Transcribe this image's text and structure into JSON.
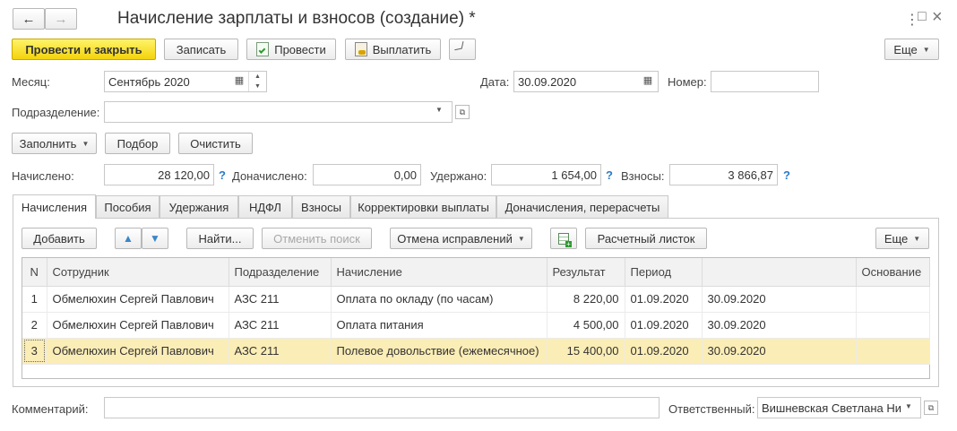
{
  "window": {
    "title": "Начисление зарплаты и взносов (создание) *",
    "more_icon": "⋮",
    "maximize_icon": "□",
    "close_icon": "×"
  },
  "nav": {
    "back": "🡐",
    "forward": "🡒"
  },
  "toolbar": {
    "post_and_close": "Провести и закрыть",
    "save": "Записать",
    "post": "Провести",
    "pay": "Выплатить",
    "more": "Еще"
  },
  "header": {
    "month_label": "Месяц:",
    "month_value": "Сентябрь 2020",
    "date_label": "Дата:",
    "date_value": "30.09.2020",
    "number_label": "Номер:",
    "number_value": "",
    "department_label": "Подразделение:",
    "department_value": ""
  },
  "actions": {
    "fill": "Заполнить",
    "select": "Подбор",
    "clear": "Очистить"
  },
  "totals": {
    "accrued_label": "Начислено:",
    "accrued_value": "28 120,00",
    "additional_label": "Доначислено:",
    "additional_value": "0,00",
    "withheld_label": "Удержано:",
    "withheld_value": "1 654,00",
    "contributions_label": "Взносы:",
    "contributions_value": "3 866,87",
    "help": "?"
  },
  "tabs": [
    {
      "label": "Начисления"
    },
    {
      "label": "Пособия"
    },
    {
      "label": "Удержания"
    },
    {
      "label": "НДФЛ"
    },
    {
      "label": "Взносы"
    },
    {
      "label": "Корректировки выплаты"
    },
    {
      "label": "Доначисления, перерасчеты"
    }
  ],
  "grid_toolbar": {
    "add": "Добавить",
    "find": "Найти...",
    "cancel_search": "Отменить поиск",
    "cancel_corrections": "Отмена исправлений",
    "payslip": "Расчетный листок",
    "more": "Еще"
  },
  "grid": {
    "columns": [
      "N",
      "Сотрудник",
      "Подразделение",
      "Начисление",
      "Результат",
      "Период",
      "",
      "Основание"
    ],
    "rows": [
      {
        "n": "1",
        "employee": "Обмелюхин Сергей Павлович",
        "department": "АЗС 211",
        "accrual": "Оплата по окладу (по часам)",
        "result": "8 220,00",
        "period_from": "01.09.2020",
        "period_to": "30.09.2020",
        "basis": ""
      },
      {
        "n": "2",
        "employee": "Обмелюхин Сергей Павлович",
        "department": "АЗС 211",
        "accrual": "Оплата питания",
        "result": "4 500,00",
        "period_from": "01.09.2020",
        "period_to": "30.09.2020",
        "basis": ""
      },
      {
        "n": "3",
        "employee": "Обмелюхин Сергей Павлович",
        "department": "АЗС 211",
        "accrual": "Полевое довольствие (ежемесячное)",
        "result": "15 400,00",
        "period_from": "01.09.2020",
        "period_to": "30.09.2020",
        "basis": ""
      }
    ]
  },
  "footer": {
    "comment_label": "Комментарий:",
    "comment_value": "",
    "responsible_label": "Ответственный:",
    "responsible_value": "Вишневская Светлана Ни"
  },
  "colors": {
    "accent": "#f4d30c",
    "selected_row": "#fbedb6",
    "help": "#2a7bc8"
  }
}
